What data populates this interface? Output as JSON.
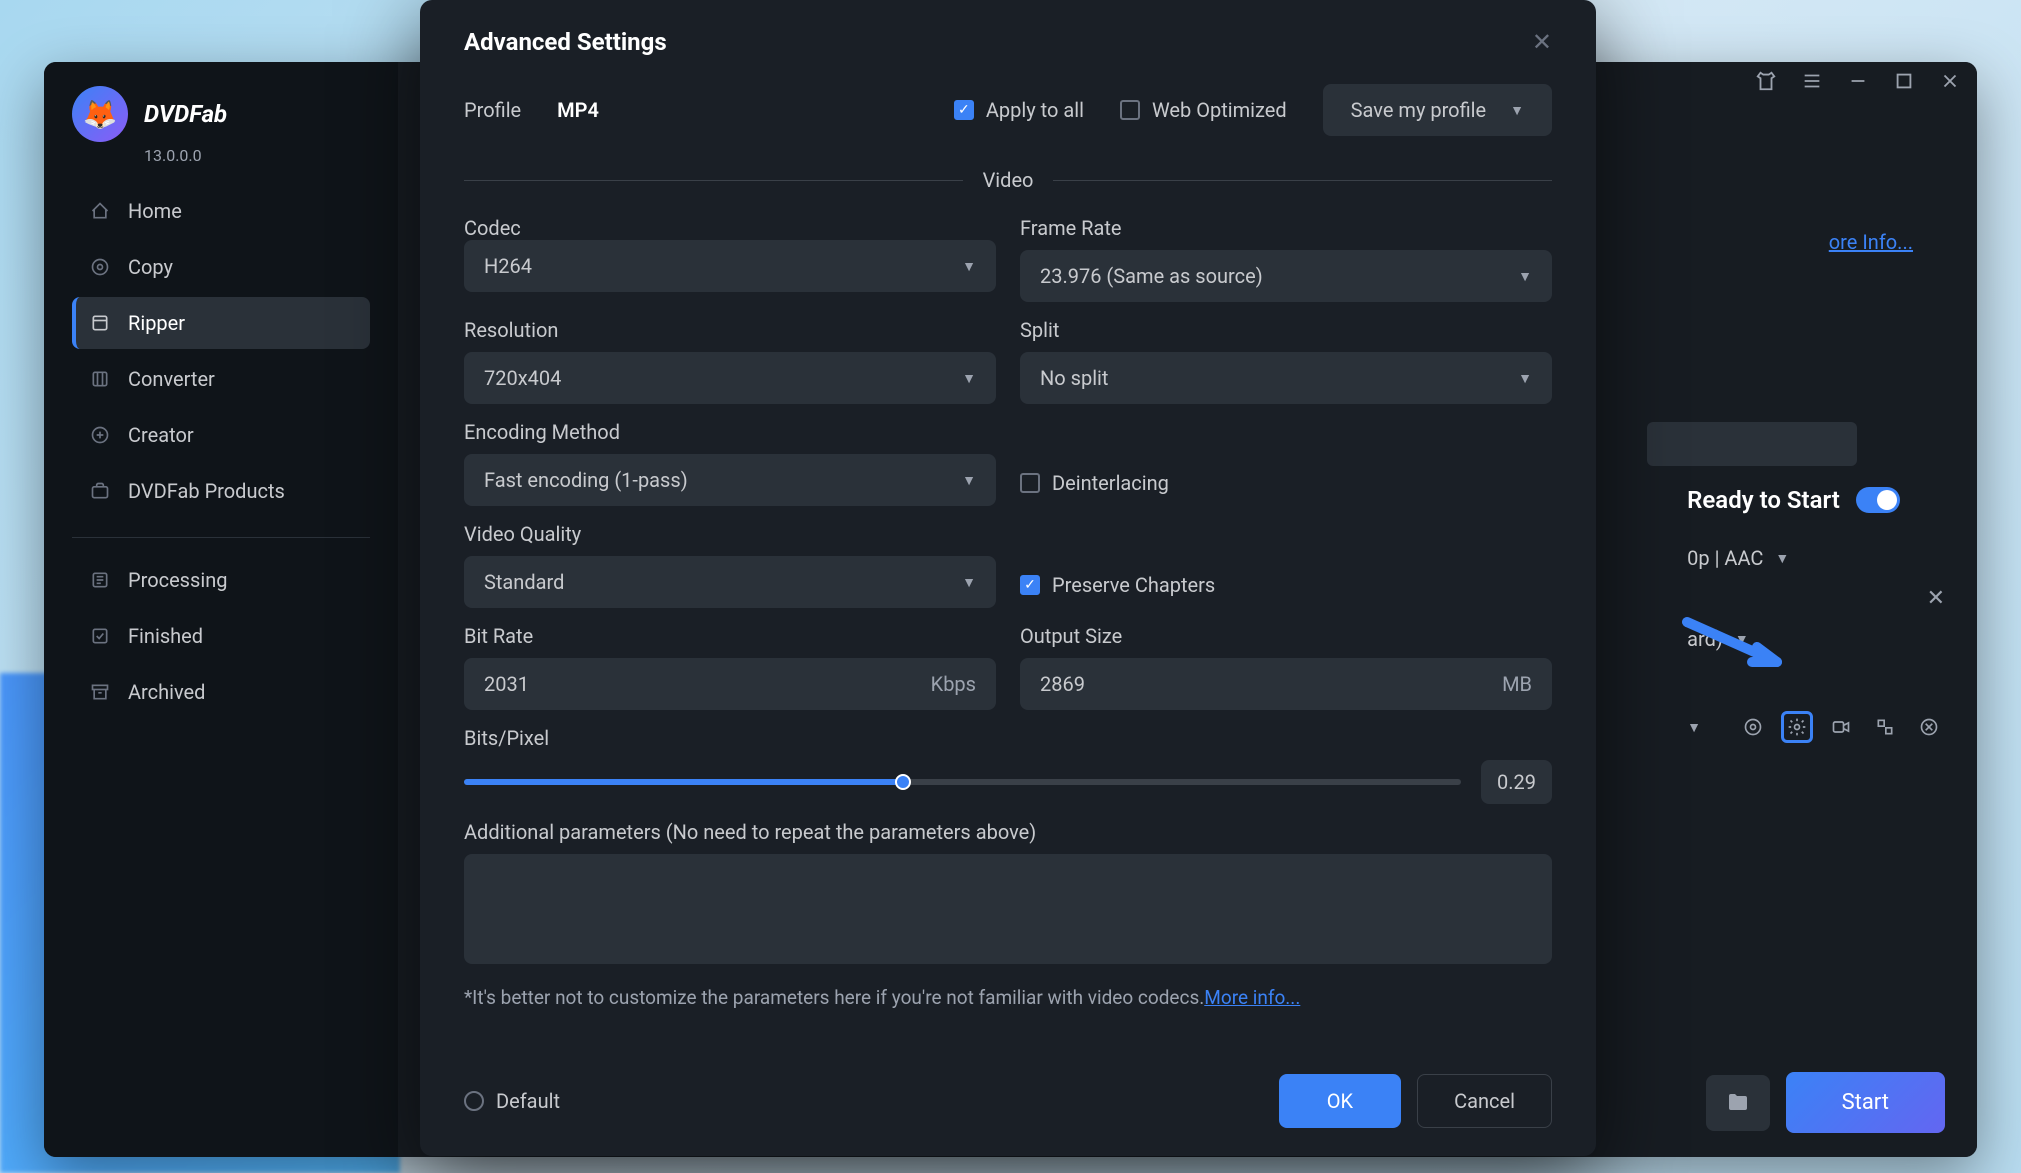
{
  "app": {
    "name": "DVDFab",
    "version": "13.0.0.0"
  },
  "sidebar": {
    "items": [
      {
        "label": "Home"
      },
      {
        "label": "Copy"
      },
      {
        "label": "Ripper"
      },
      {
        "label": "Converter"
      },
      {
        "label": "Creator"
      },
      {
        "label": "DVDFab Products"
      },
      {
        "label": "Processing"
      },
      {
        "label": "Finished"
      },
      {
        "label": "Archived"
      }
    ],
    "active_index": 2
  },
  "topbar": {
    "more_info": "ore Info..."
  },
  "status": {
    "ready": "Ready to Start",
    "line1": "0p | AAC",
    "line2": "ard)"
  },
  "bottom": {
    "start": "Start"
  },
  "modal": {
    "title": "Advanced Settings",
    "profile_label": "Profile",
    "profile_value": "MP4",
    "apply_to_all": "Apply to all",
    "web_optimized": "Web Optimized",
    "save_profile": "Save my profile",
    "video_section": "Video",
    "labels": {
      "codec": "Codec",
      "frame_rate": "Frame Rate",
      "resolution": "Resolution",
      "split": "Split",
      "encoding": "Encoding Method",
      "deinterlacing": "Deinterlacing",
      "quality": "Video Quality",
      "preserve": "Preserve Chapters",
      "bitrate": "Bit Rate",
      "output_size": "Output Size",
      "bits_pixel": "Bits/Pixel",
      "additional": "Additional parameters (No need to repeat the parameters above)"
    },
    "values": {
      "codec": "H264",
      "frame_rate": "23.976 (Same as source)",
      "resolution": "720x404",
      "split": "No split",
      "encoding": "Fast encoding (1-pass)",
      "quality": "Standard",
      "bitrate": "2031",
      "bitrate_unit": "Kbps",
      "output_size": "2869",
      "output_unit": "MB",
      "bits_pixel": "0.29"
    },
    "note": "*It's better not to customize the parameters here if you're not familiar with video codecs.",
    "more_info": "More info...",
    "default": "Default",
    "ok": "OK",
    "cancel": "Cancel"
  }
}
